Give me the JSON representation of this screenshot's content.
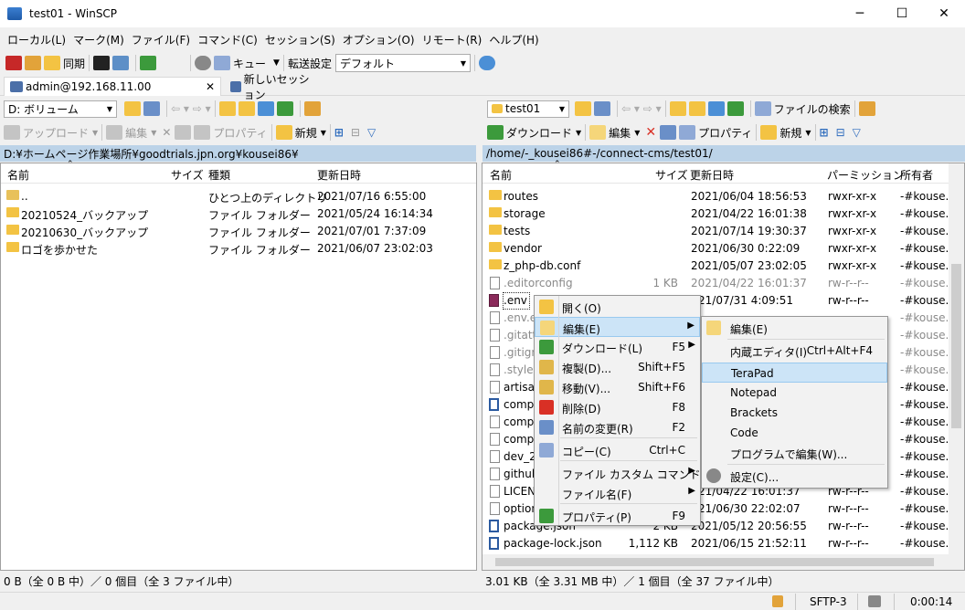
{
  "window": {
    "title": "test01 - WinSCP",
    "min": "─",
    "max": "☐",
    "close": "✕"
  },
  "menubar": [
    "ローカル(L)",
    "マーク(M)",
    "ファイル(F)",
    "コマンド(C)",
    "セッション(S)",
    "オプション(O)",
    "リモート(R)",
    "ヘルプ(H)"
  ],
  "toolbar": {
    "sync": "同期",
    "queue": "キュー",
    "transfer_label": "転送設定",
    "transfer_value": "デフォルト"
  },
  "tabs": {
    "session": "admin@192.168.11.00",
    "new_session": "新しいセッション",
    "close": "✕"
  },
  "left": {
    "drive": "D: ボリューム",
    "upload": "アップロード",
    "edit": "編集",
    "properties": "プロパティ",
    "new": "新規",
    "path": "D:¥ホームページ作業場所¥goodtrials.jpn.org¥kousei86¥",
    "columns": [
      "名前",
      "サイズ",
      "種類",
      "更新日時"
    ],
    "rows": [
      {
        "name": "..",
        "size": "",
        "type": "ひとつ上のディレクトリ",
        "date": "2021/07/16  6:55:00",
        "kind": "up"
      },
      {
        "name": "20210524_バックアップ",
        "size": "",
        "type": "ファイル フォルダー",
        "date": "2021/05/24  16:14:34",
        "kind": "folder"
      },
      {
        "name": "20210630_バックアップ",
        "size": "",
        "type": "ファイル フォルダー",
        "date": "2021/07/01  7:37:09",
        "kind": "folder"
      },
      {
        "name": "ロゴを歩かせた",
        "size": "",
        "type": "ファイル フォルダー",
        "date": "2021/06/07  23:02:03",
        "kind": "folder"
      }
    ],
    "status": "0 B（全 0 B 中）／ 0 個目（全 3 ファイル中）"
  },
  "right": {
    "folder": "test01",
    "download": "ダウンロード",
    "edit": "編集",
    "properties": "プロパティ",
    "new": "新規",
    "find": "ファイルの検索",
    "path": "/home/-_kousei86#-/connect-cms/test01/",
    "columns": [
      "名前",
      "サイズ",
      "更新日時",
      "パーミッション",
      "所有者"
    ],
    "rows": [
      {
        "name": "routes",
        "size": "",
        "date": "2021/06/04 18:56:53",
        "perm": "rwxr-xr-x",
        "owner": "-#kouse...",
        "kind": "folder",
        "dim": false
      },
      {
        "name": "storage",
        "size": "",
        "date": "2021/04/22 16:01:38",
        "perm": "rwxr-xr-x",
        "owner": "-#kouse...",
        "kind": "folder",
        "dim": false
      },
      {
        "name": "tests",
        "size": "",
        "date": "2021/07/14 19:30:37",
        "perm": "rwxr-xr-x",
        "owner": "-#kouse...",
        "kind": "folder",
        "dim": false
      },
      {
        "name": "vendor",
        "size": "",
        "date": "2021/06/30 0:22:09",
        "perm": "rwxr-xr-x",
        "owner": "-#kouse...",
        "kind": "folder",
        "dim": false
      },
      {
        "name": "z_php-db.conf",
        "size": "",
        "date": "2021/05/07 23:02:05",
        "perm": "rwxr-xr-x",
        "owner": "-#kouse...",
        "kind": "folder",
        "dim": false
      },
      {
        "name": ".editorconfig",
        "size": "1 KB",
        "date": "2021/04/22 16:01:37",
        "perm": "rw-r--r--",
        "owner": "-#kouse...",
        "kind": "file",
        "dim": true
      },
      {
        "name": ".env",
        "size": "",
        "date": "21/07/31 4:09:51",
        "perm": "rw-r--r--",
        "owner": "-#kouse...",
        "kind": "env",
        "dim": false
      },
      {
        "name": ".env.ex",
        "size": "",
        "date": "",
        "perm": "",
        "owner": "-#kouse...",
        "kind": "file",
        "dim": true
      },
      {
        "name": ".gitatt",
        "size": "",
        "date": "",
        "perm": "",
        "owner": "-#kouse...",
        "kind": "file",
        "dim": true
      },
      {
        "name": ".gitign",
        "size": "",
        "date": "",
        "perm": "",
        "owner": "-#kouse...",
        "kind": "file",
        "dim": true
      },
      {
        "name": ".stylec",
        "size": "",
        "date": "",
        "perm": "",
        "owner": "-#kouse...",
        "kind": "file",
        "dim": true
      },
      {
        "name": "artisan",
        "size": "",
        "date": "",
        "perm": "",
        "owner": "-#kouse...",
        "kind": "file",
        "dim": false
      },
      {
        "name": "compo",
        "size": "",
        "date": "",
        "perm": "",
        "owner": "-#kouse...",
        "kind": "json",
        "dim": false
      },
      {
        "name": "compo",
        "size": "",
        "date": "",
        "perm": "",
        "owner": "-#kouse...",
        "kind": "file",
        "dim": false
      },
      {
        "name": "compo",
        "size": "",
        "date": "",
        "perm": "",
        "owner": "-#kouse...",
        "kind": "file",
        "dim": false
      },
      {
        "name": "dev_2_",
        "size": "",
        "date": "",
        "perm": "",
        "owner": "-#kouse...",
        "kind": "file",
        "dim": false
      },
      {
        "name": "github",
        "size": "",
        "date": "",
        "perm": "",
        "owner": "-#kouse...",
        "kind": "file",
        "dim": false
      },
      {
        "name": "LICENS",
        "size": "",
        "date": "21/04/22 16:01:37",
        "perm": "rw-r--r--",
        "owner": "-#kouse...",
        "kind": "file",
        "dim": false
      },
      {
        "name": "option",
        "size": "",
        "date": "21/06/30 22:02:07",
        "perm": "rw-r--r--",
        "owner": "-#kouse...",
        "kind": "file",
        "dim": false
      },
      {
        "name": "package.json",
        "size": "2 KB",
        "date": "2021/05/12 20:56:55",
        "perm": "rw-r--r--",
        "owner": "-#kouse...",
        "kind": "json",
        "dim": false
      },
      {
        "name": "package-lock.json",
        "size": "1,112 KB",
        "date": "2021/06/15 21:52:11",
        "perm": "rw-r--r--",
        "owner": "-#kouse...",
        "kind": "json",
        "dim": false
      }
    ],
    "status": "3.01 KB（全 3.31 MB 中）／ 1 個目（全 37 ファイル中）"
  },
  "context_menu": [
    {
      "label": "開く(O)",
      "sc": "",
      "arrow": false,
      "color": "#f3c343"
    },
    {
      "label": "編集(E)",
      "sc": "",
      "arrow": true,
      "color": "#f5d67a",
      "hl": true
    },
    {
      "label": "ダウンロード(L)",
      "sc": "F5",
      "arrow": true,
      "color": "#3c9a3c"
    },
    {
      "label": "複製(D)...",
      "sc": "Shift+F5",
      "arrow": false,
      "color": "#e0b64a"
    },
    {
      "label": "移動(V)...",
      "sc": "Shift+F6",
      "arrow": false,
      "color": "#e0b64a"
    },
    {
      "label": "削除(D)",
      "sc": "F8",
      "arrow": false,
      "color": "#d93025"
    },
    {
      "label": "名前の変更(R)",
      "sc": "F2",
      "arrow": false,
      "color": "#6a8fc8"
    },
    {
      "label": "コピー(C)",
      "sc": "Ctrl+C",
      "arrow": false,
      "color": "#8fa9d6"
    },
    {
      "label": "ファイル カスタム コマンド(C)",
      "sc": "",
      "arrow": true,
      "color": ""
    },
    {
      "label": "ファイル名(F)",
      "sc": "",
      "arrow": true,
      "color": ""
    },
    {
      "label": "プロパティ(P)",
      "sc": "F9",
      "arrow": false,
      "color": "#3c9a3c"
    }
  ],
  "edit_submenu": [
    {
      "label": "編集(E)",
      "sc": ""
    },
    {
      "label": "内蔵エディタ(I)",
      "sc": "Ctrl+Alt+F4"
    },
    {
      "label": "TeraPad",
      "sc": "",
      "hl": true
    },
    {
      "label": "Notepad",
      "sc": ""
    },
    {
      "label": "Brackets",
      "sc": ""
    },
    {
      "label": "Code",
      "sc": ""
    },
    {
      "label": "プログラムで編集(W)...",
      "sc": ""
    },
    {
      "label": "設定(C)...",
      "sc": ""
    }
  ],
  "bottom": {
    "protocol": "SFTP-3",
    "time": "0:00:14"
  }
}
